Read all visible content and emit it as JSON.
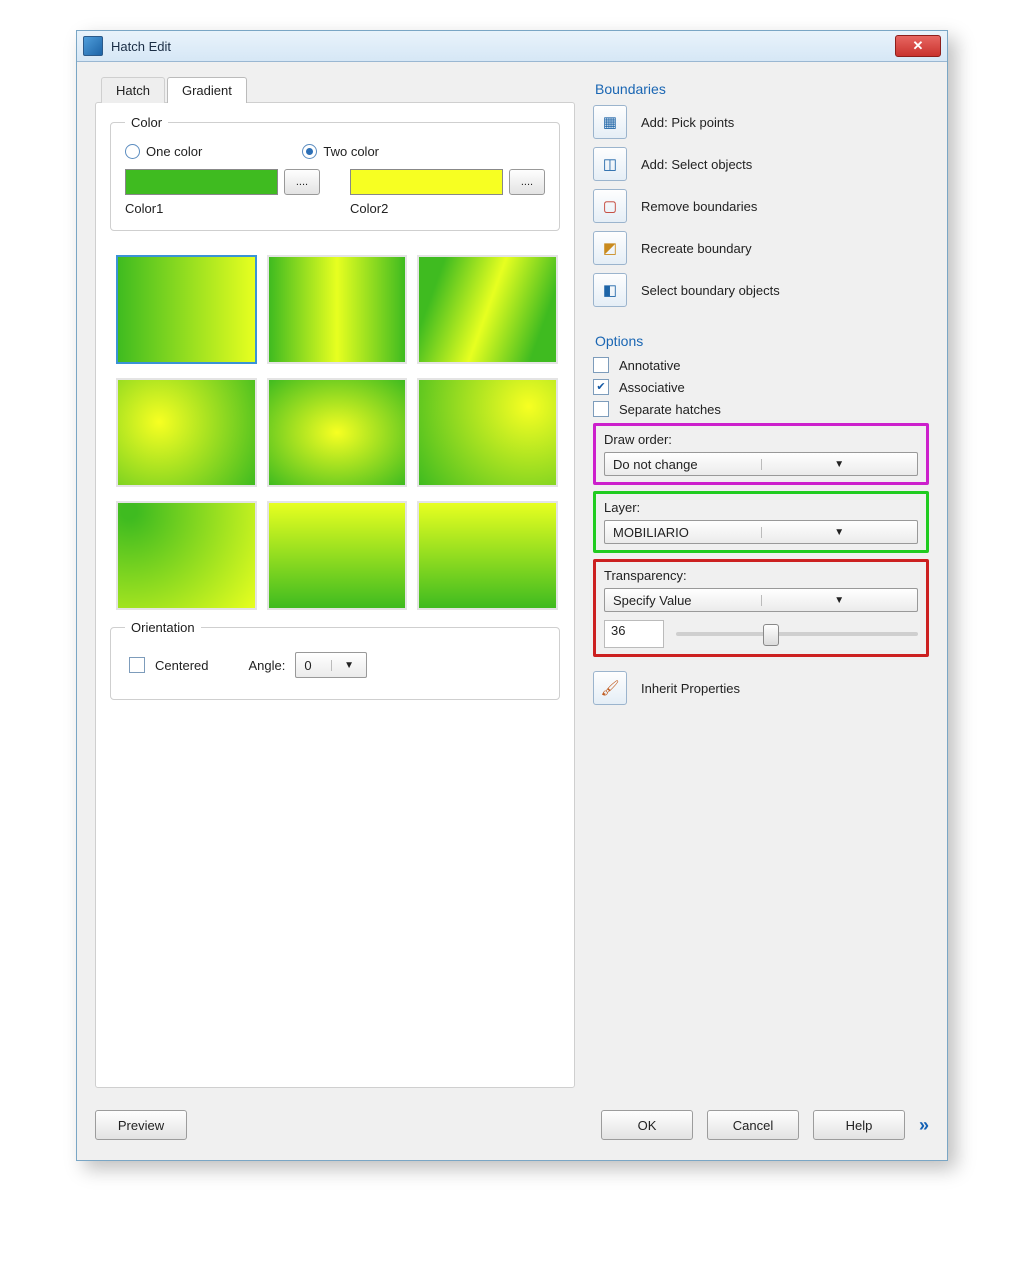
{
  "window": {
    "title": "Hatch Edit"
  },
  "tabs": {
    "hatch": "Hatch",
    "gradient": "Gradient",
    "active": "gradient"
  },
  "color": {
    "group": "Color",
    "one": "One color",
    "two": "Two color",
    "selected": "two",
    "label1": "Color1",
    "label2": "Color2",
    "more": "....",
    "color1": "#3fbb20",
    "color2": "#f7ff22"
  },
  "orientation": {
    "group": "Orientation",
    "centered": "Centered",
    "centered_checked": false,
    "angle_label": "Angle:",
    "angle_value": "0"
  },
  "boundaries": {
    "title": "Boundaries",
    "items": [
      {
        "icon": "plus-square",
        "label": "Add: Pick points"
      },
      {
        "icon": "select-plus",
        "label": "Add: Select objects"
      },
      {
        "icon": "remove",
        "label": "Remove boundaries"
      },
      {
        "icon": "recreate",
        "label": "Recreate boundary"
      },
      {
        "icon": "select-boundary",
        "label": "Select boundary objects"
      }
    ]
  },
  "options": {
    "title": "Options",
    "annotative": "Annotative",
    "annotative_checked": false,
    "associative": "Associative",
    "associative_checked": true,
    "separate": "Separate hatches",
    "separate_checked": false
  },
  "draw_order": {
    "label": "Draw order:",
    "value": "Do not change"
  },
  "layer": {
    "label": "Layer:",
    "value": "MOBILIARIO"
  },
  "transparency": {
    "label": "Transparency:",
    "mode": "Specify Value",
    "value": "36",
    "slider_pct": 36
  },
  "inherit": {
    "label": "Inherit Properties"
  },
  "buttons": {
    "preview": "Preview",
    "ok": "OK",
    "cancel": "Cancel",
    "help": "Help"
  }
}
